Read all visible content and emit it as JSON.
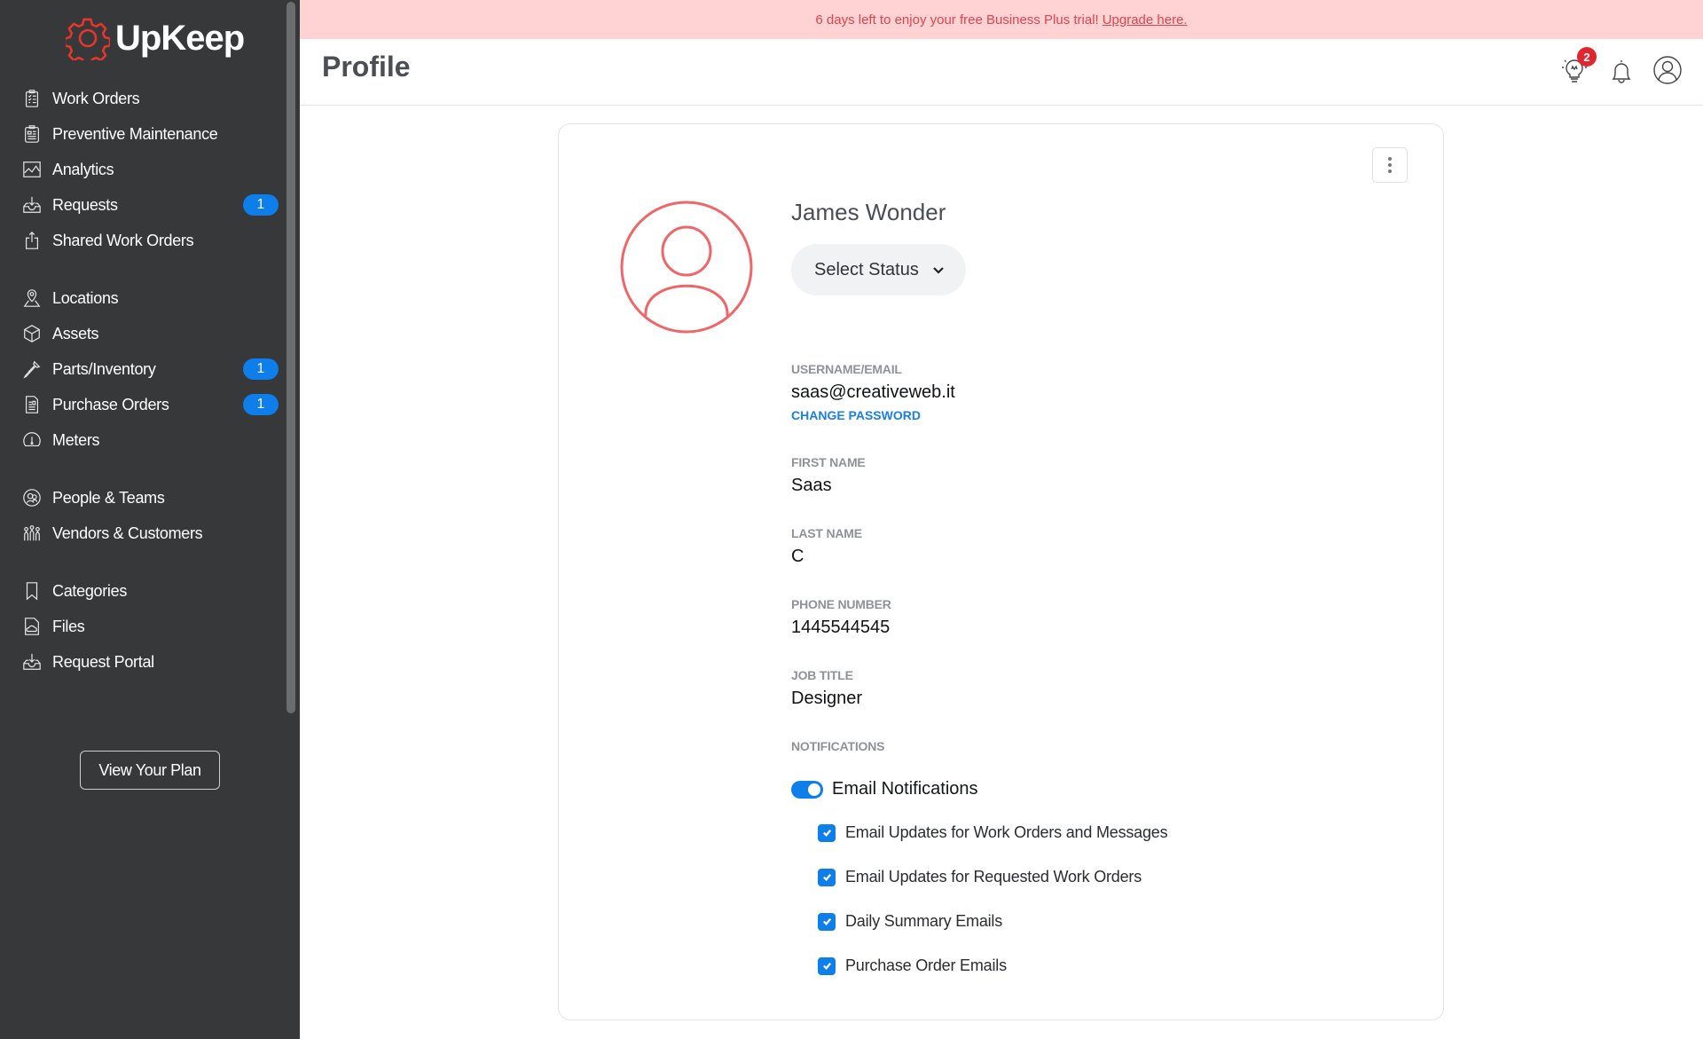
{
  "app": {
    "name": "UpKeep"
  },
  "banner": {
    "text": "6 days left to enjoy your free Business Plus trial!",
    "link": "Upgrade here."
  },
  "sidebar": {
    "items": [
      {
        "label": "Work Orders",
        "icon": "clipboard-checklist-icon",
        "badge": null
      },
      {
        "label": "Preventive Maintenance",
        "icon": "clipboard-schedule-icon",
        "badge": null
      },
      {
        "label": "Analytics",
        "icon": "chart-line-icon",
        "badge": null
      },
      {
        "label": "Requests",
        "icon": "inbox-download-icon",
        "badge": "1"
      },
      {
        "label": "Shared Work Orders",
        "icon": "share-upload-icon",
        "badge": null
      },
      {
        "label": "Locations",
        "icon": "map-pin-icon",
        "badge": null
      },
      {
        "label": "Assets",
        "icon": "cube-icon",
        "badge": null
      },
      {
        "label": "Parts/Inventory",
        "icon": "screw-icon",
        "badge": "1"
      },
      {
        "label": "Purchase Orders",
        "icon": "document-icon",
        "badge": "1"
      },
      {
        "label": "Meters",
        "icon": "gauge-icon",
        "badge": null
      },
      {
        "label": "People & Teams",
        "icon": "people-icon",
        "badge": null
      },
      {
        "label": "Vendors & Customers",
        "icon": "group-icon",
        "badge": null
      },
      {
        "label": "Categories",
        "icon": "bookmark-icon",
        "badge": null
      },
      {
        "label": "Files",
        "icon": "file-cloud-icon",
        "badge": null
      },
      {
        "label": "Request Portal",
        "icon": "inbox-download-icon",
        "badge": null
      }
    ],
    "plan_button": "View Your Plan"
  },
  "header": {
    "title": "Profile",
    "tips_badge": "2"
  },
  "profile": {
    "name": "James Wonder",
    "status_select": "Select Status",
    "fields": {
      "username_label": "USERNAME/EMAIL",
      "username_value": "saas@creativeweb.it",
      "change_password": "CHANGE PASSWORD",
      "first_name_label": "FIRST NAME",
      "first_name_value": "Saas",
      "last_name_label": "LAST NAME",
      "last_name_value": "C",
      "phone_label": "PHONE NUMBER",
      "phone_value": "1445544545",
      "job_label": "JOB TITLE",
      "job_value": "Designer",
      "notifications_label": "NOTIFICATIONS"
    },
    "email_notifications": {
      "label": "Email Notifications",
      "enabled": true
    },
    "options": [
      {
        "label": "Email Updates for Work Orders and Messages",
        "checked": true
      },
      {
        "label": "Email Updates for Requested Work Orders",
        "checked": true
      },
      {
        "label": "Daily Summary Emails",
        "checked": true
      },
      {
        "label": "Purchase Order Emails",
        "checked": true
      }
    ]
  },
  "colors": {
    "accent": "#0d7eea",
    "brand": "#e8362d",
    "sidebar_bg": "#373839",
    "banner_bg": "#ffd2d3",
    "avatar": "#f06567"
  }
}
